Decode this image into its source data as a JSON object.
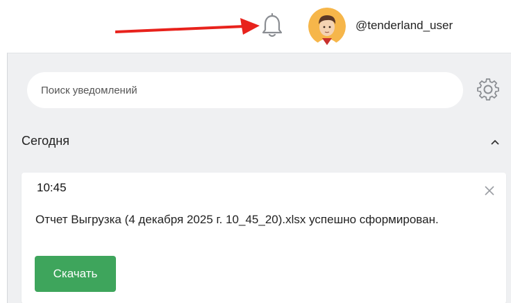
{
  "header": {
    "username": "@tenderland_user",
    "icons": {
      "bell": "bell-icon",
      "avatar": "avatar",
      "arrow": "pointer-arrow"
    }
  },
  "search": {
    "placeholder": "Поиск уведомлений",
    "value": ""
  },
  "settings": {
    "icon": "gear-icon"
  },
  "section": {
    "title": "Сегодня",
    "collapse_icon": "chevron-up-icon"
  },
  "notifications": [
    {
      "time": "10:45",
      "message": "Отчет Выгрузка (4 декабря 2025 г. 10_45_20).xlsx успешно сформирован.",
      "action_label": "Скачать"
    }
  ],
  "colors": {
    "accent_green": "#3ea55c",
    "arrow_red": "#e8221c",
    "panel_bg": "#eff0f2"
  }
}
